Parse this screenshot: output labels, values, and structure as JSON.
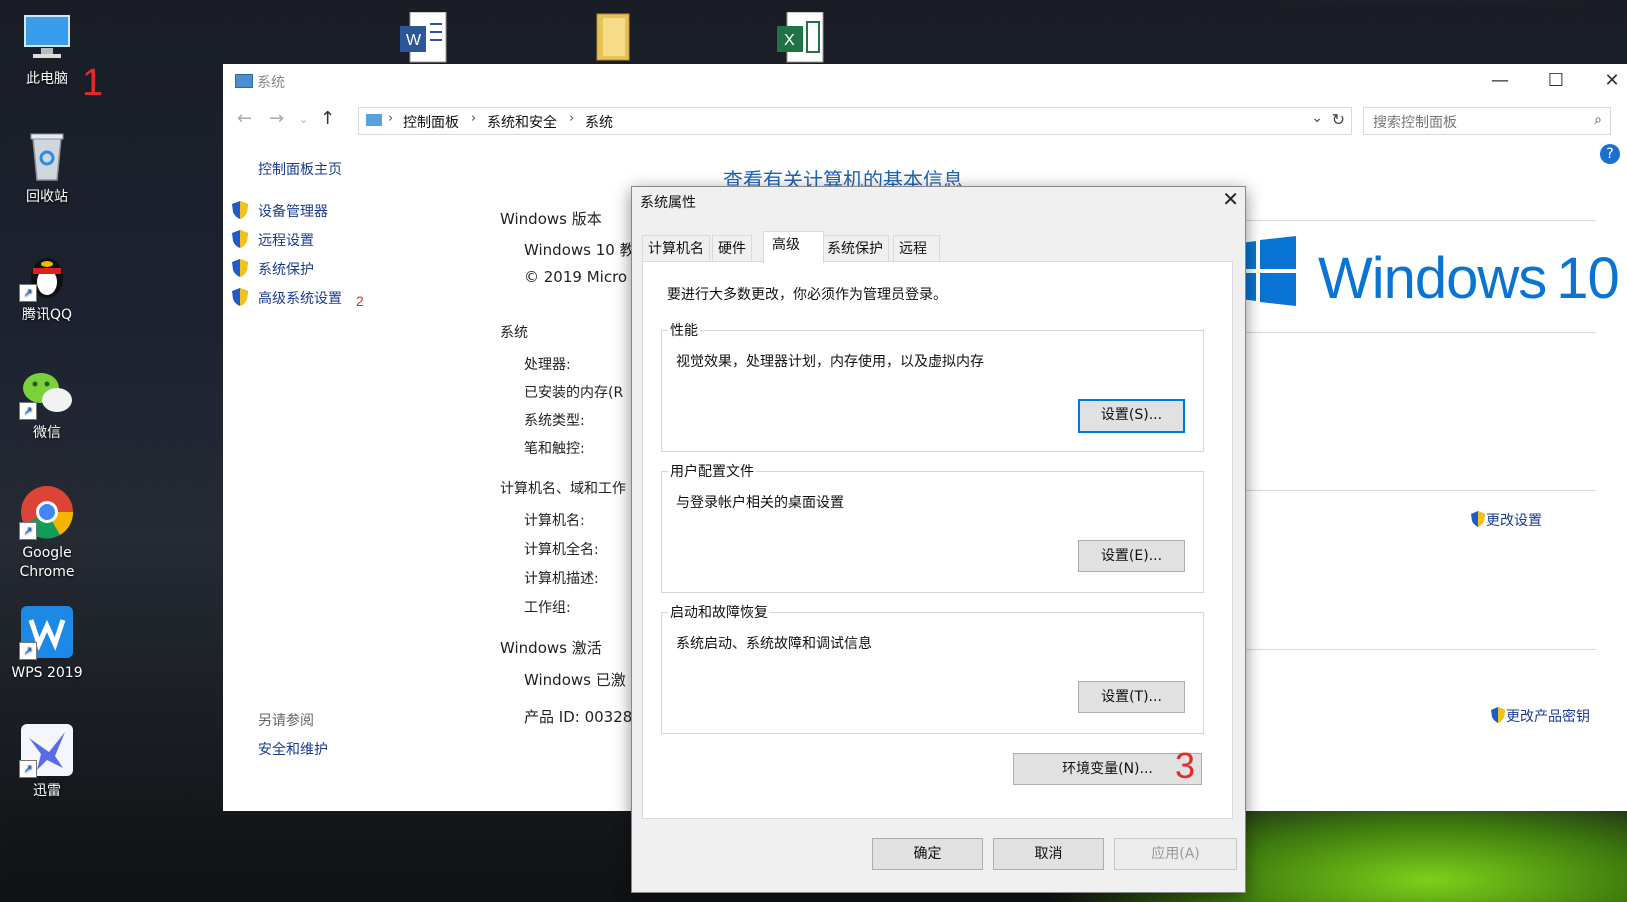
{
  "desktop": {
    "icons": [
      {
        "label": "此电脑"
      },
      {
        "label": "回收站"
      },
      {
        "label": "腾讯QQ"
      },
      {
        "label": "微信"
      },
      {
        "label": "Google Chrome"
      },
      {
        "label": "WPS 2019"
      },
      {
        "label": "迅雷"
      }
    ],
    "markers": [
      "1",
      "2",
      "3"
    ]
  },
  "window": {
    "title": "系统",
    "controls": {
      "minimize": "—",
      "maximize": "☐",
      "close": "✕"
    },
    "breadcrumb": [
      "控制面板",
      "系统和安全",
      "系统"
    ],
    "search_placeholder": "搜索控制面板",
    "help": "?"
  },
  "sidebar": {
    "home": "控制面板主页",
    "links": [
      "设备管理器",
      "远程设置",
      "系统保护",
      "高级系统设置"
    ],
    "see_also": "另请参阅",
    "see_also_links": [
      "安全和维护"
    ]
  },
  "main": {
    "title": "查看有关计算机的基本信息",
    "windows_edition": "Windows 版本",
    "edition_name": "Windows 10 教",
    "copyright": "© 2019 Micro",
    "system_section": "系统",
    "system_rows": [
      "处理器:",
      "已安装的内存(R",
      "系统类型:",
      "笔和触控:"
    ],
    "computer_section": "计算机名、域和工作",
    "computer_rows": [
      "计算机名:",
      "计算机全名:",
      "计算机描述:",
      "工作组:"
    ],
    "change_settings": "更改设置",
    "activation_section": "Windows 激活",
    "activation_status": "Windows 已激",
    "product_id": "产品 ID: 00328",
    "change_key": "更改产品密钥",
    "logo_text": "Windows",
    "logo_version": "10"
  },
  "dialog": {
    "title": "系统属性",
    "close": "✕",
    "tabs": [
      "计算机名",
      "硬件",
      "高级",
      "系统保护",
      "远程"
    ],
    "active_tab": "高级",
    "admin_note": "要进行大多数更改，你必须作为管理员登录。",
    "groups": [
      {
        "title": "性能",
        "desc": "视觉效果，处理器计划，内存使用，以及虚拟内存",
        "button": "设置(S)..."
      },
      {
        "title": "用户配置文件",
        "desc": "与登录帐户相关的桌面设置",
        "button": "设置(E)..."
      },
      {
        "title": "启动和故障恢复",
        "desc": "系统启动、系统故障和调试信息",
        "button": "设置(T)..."
      }
    ],
    "env_button": "环境变量(N)...",
    "ok": "确定",
    "cancel": "取消",
    "apply": "应用(A)"
  },
  "colors": {
    "link": "#1a3c90",
    "title_blue": "#1e64b6",
    "logo_blue": "#0a74d4",
    "marker_red": "#e8292a"
  }
}
